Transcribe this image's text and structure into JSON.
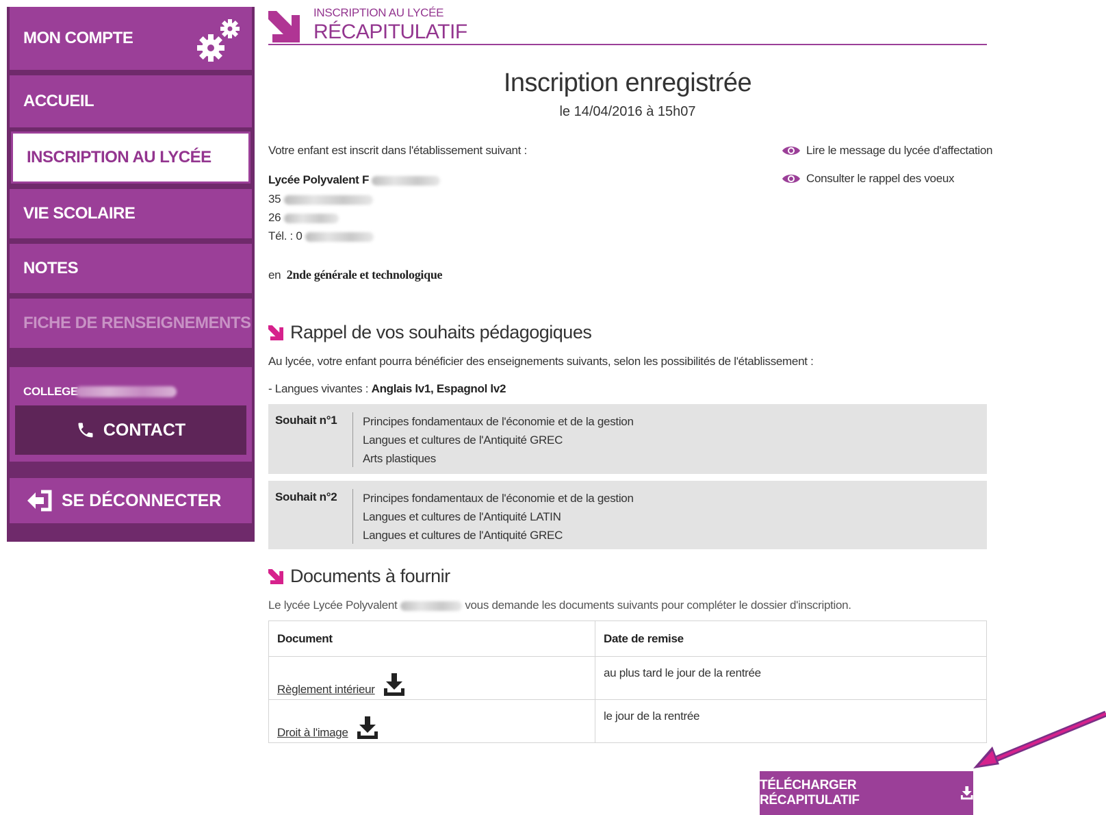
{
  "sidebar": {
    "account": "MON COMPTE",
    "items": [
      {
        "label": "ACCUEIL"
      },
      {
        "label": "INSCRIPTION AU LYCÉE"
      },
      {
        "label": "VIE SCOLAIRE"
      },
      {
        "label": "NOTES"
      },
      {
        "label": "FICHE DE RENSEIGNEMENTS"
      }
    ],
    "college_label": "COLLEGE",
    "contact_label": "CONTACT",
    "logout_label": "SE DÉCONNECTER"
  },
  "header": {
    "breadcrumb": "INSCRIPTION AU LYCÉE",
    "title": "RÉCAPITULATIF"
  },
  "main": {
    "title": "Inscription enregistrée",
    "date": "le 14/04/2016 à 15h07",
    "intro": "Votre enfant est inscrit dans l'établissement suivant :",
    "school_name": "Lycée Polyvalent F",
    "address_line1": "35",
    "address_line2": "26",
    "phone": "Tél. : 0",
    "class_prefix": "en",
    "class_name": "2nde générale et technologique",
    "links": {
      "message": "Lire le message du lycée d'affectation",
      "wishes": "Consulter le rappel des voeux"
    }
  },
  "wishes_section": {
    "heading": "Rappel de vos souhaits pédagogiques",
    "intro": "Au lycée, votre enfant pourra bénéficier des enseignements suivants, selon les possibilités de l'établissement :",
    "languages_label": "- Langues vivantes :",
    "languages_value": "Anglais lv1, Espagnol lv2",
    "wishes": [
      {
        "label": "Souhait n°1",
        "items": [
          "Principes fondamentaux de l'économie et de la gestion",
          "Langues et cultures de l'Antiquité GREC",
          "Arts plastiques"
        ]
      },
      {
        "label": "Souhait n°2",
        "items": [
          "Principes fondamentaux de l'économie et de la gestion",
          "Langues et cultures de l'Antiquité LATIN",
          "Langues et cultures de l'Antiquité GREC"
        ]
      }
    ]
  },
  "documents_section": {
    "heading": "Documents à fournir",
    "intro_prefix": "Le lycée Lycée Polyvalent",
    "intro_suffix": "vous demande les documents suivants pour compléter le dossier d'inscription.",
    "columns": [
      "Document",
      "Date de remise"
    ],
    "rows": [
      {
        "document": "Règlement intérieur",
        "date": "au plus tard le jour de la rentrée"
      },
      {
        "document": "Droit à l'image",
        "date": "le jour de la rentrée"
      }
    ]
  },
  "download_label": "TÉLÉCHARGER RÉCAPITULATIF",
  "colors": {
    "brand": "#9b3f98",
    "brand_dark": "#6f2a6b",
    "accent_magenta": "#d6218c",
    "wish_background": "#e3e3e3"
  },
  "icons": [
    "gears-icon",
    "phone-icon",
    "logout-icon",
    "arrow-icon",
    "eye-icon",
    "download-icon"
  ]
}
